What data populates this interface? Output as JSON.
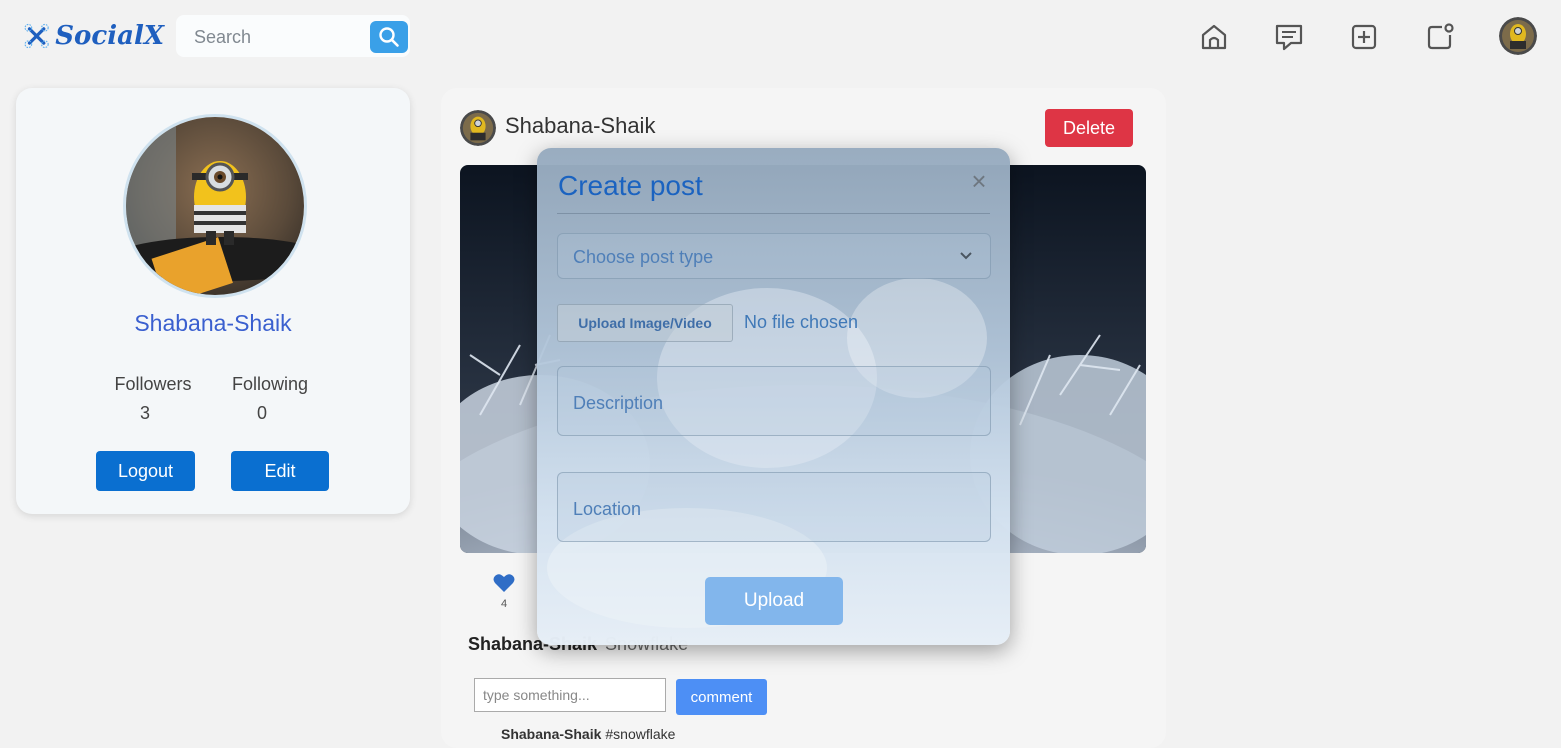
{
  "header": {
    "logo": {
      "icon": "drone-x-icon",
      "text": "SocialX"
    },
    "search": {
      "placeholder": "Search",
      "icon": "search-icon"
    },
    "nav": [
      {
        "name": "home",
        "icon": "home-icon"
      },
      {
        "name": "messages",
        "icon": "message-icon"
      },
      {
        "name": "create",
        "icon": "plus-square-icon"
      },
      {
        "name": "notifications",
        "icon": "notification-icon"
      }
    ],
    "avatar_icon": "avatar-icon"
  },
  "profile": {
    "name": "Shabana-Shaik",
    "followers_label": "Followers",
    "followers_count": "3",
    "following_label": "Following",
    "following_count": "0",
    "logout_label": "Logout",
    "edit_label": "Edit"
  },
  "post": {
    "username": "Shabana-Shaik",
    "delete_label": "Delete",
    "likes": "4",
    "caption_user": "Shabana-Shaik",
    "caption_text": "Snowflake",
    "comment_placeholder": "type something...",
    "comment_button": "comment",
    "comments": [
      {
        "user": "Shabana-Shaik",
        "text": "#snowflake"
      }
    ]
  },
  "modal": {
    "title": "Create post",
    "close_symbol": "×",
    "post_type_placeholder": "Choose post type",
    "upload_file_label": "Upload Image/Video",
    "no_file_text": "No file chosen",
    "description_placeholder": "Description",
    "location_placeholder": "Location",
    "upload_label": "Upload"
  },
  "colors": {
    "accent": "#0a6fd0",
    "delete": "#de3545",
    "upload_button": "#82b6ec",
    "comment_button": "#4d8ff5",
    "search_button": "#3aa0e8",
    "modal_title": "#1b63c0"
  }
}
